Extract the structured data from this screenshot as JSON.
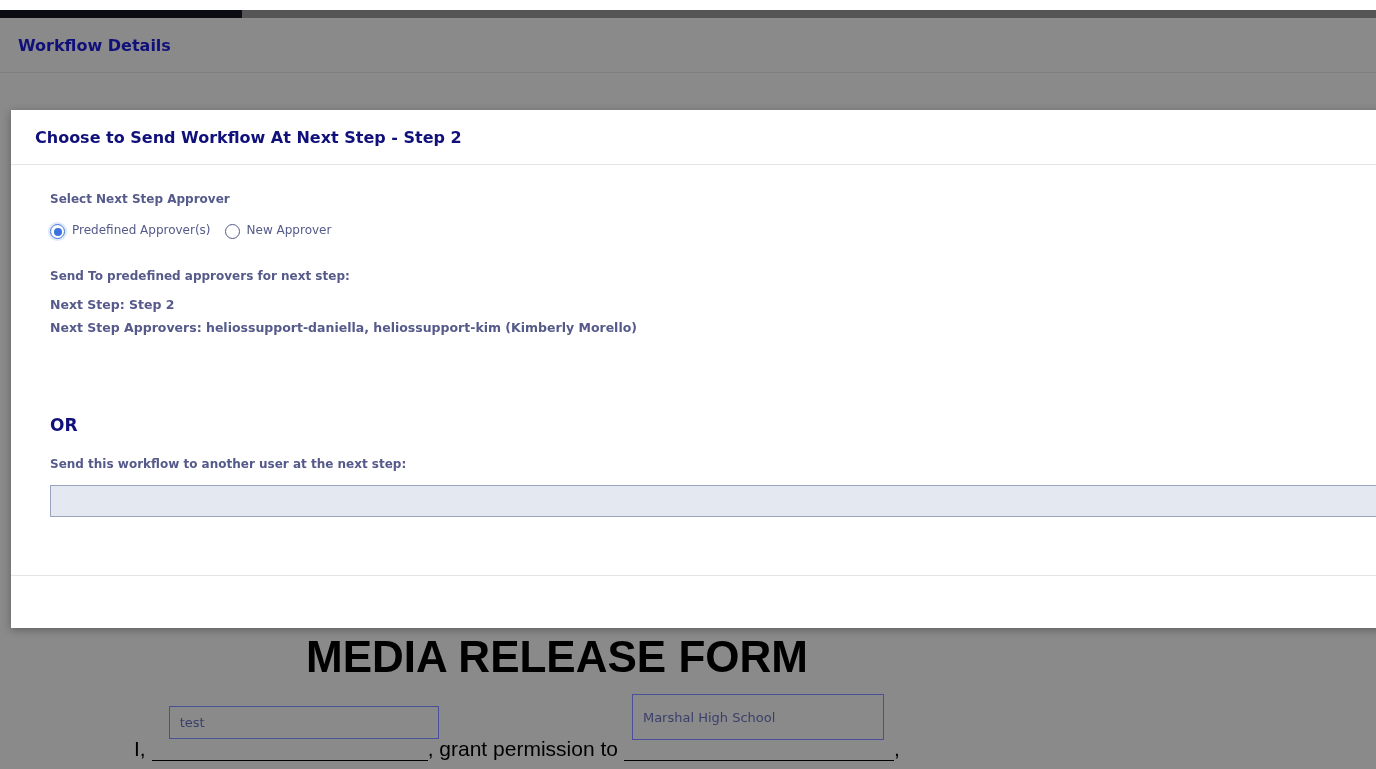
{
  "progress": {
    "level": 0.176
  },
  "page": {
    "title": "Workflow Details",
    "form": {
      "heading": "MEDIA RELEASE FORM",
      "line_1": {
        "start": "I,",
        "name_field": {
          "value": "test"
        },
        "middle": ", grant permission to",
        "org_field": {
          "value": "Marshal High School"
        },
        "end": ","
      }
    }
  },
  "dialog": {
    "title": "Choose to Send Workflow At Next Step - Step 2",
    "approver_label": "Select Next Step Approver",
    "options": [
      {
        "label": "Predefined Approver(s)",
        "selected": true
      },
      {
        "label": "New Approver",
        "selected": false
      }
    ],
    "predefined_label": "Send To predefined approvers for next step:",
    "next_step": "Next Step: Step 2",
    "next_approvers": "Next Step Approvers: heliossupport-daniella, heliossupport-kim (Kimberly Morello)",
    "or": "OR",
    "other_user_label": "Send this workflow to another user at the next step:"
  }
}
